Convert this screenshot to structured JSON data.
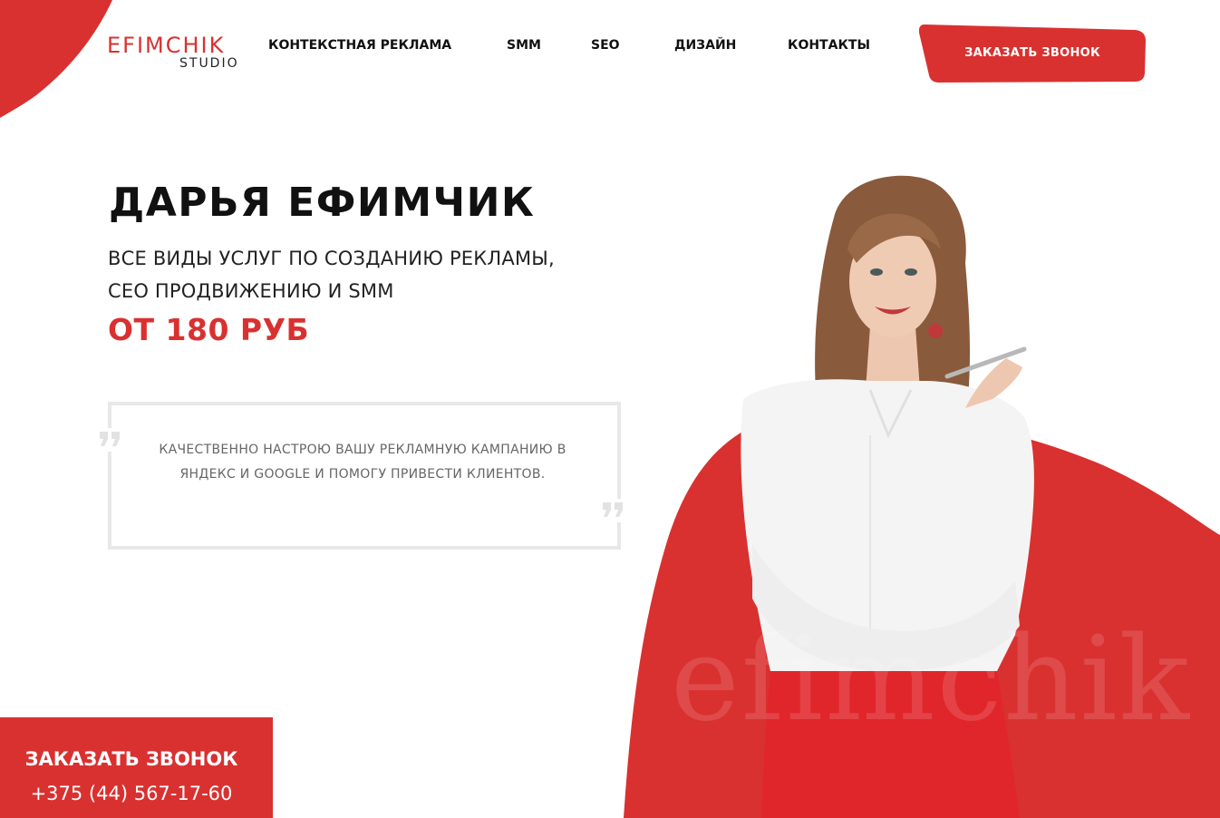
{
  "brand": {
    "logo_main": "EFIMCHIK",
    "logo_sub": "STUDIO",
    "accent_color": "#d93130",
    "watermark": "efimchik"
  },
  "nav": {
    "items": [
      {
        "label": "КОНТЕКСТНАЯ РЕКЛАМА"
      },
      {
        "label": "SMM"
      },
      {
        "label": "SEO"
      },
      {
        "label": "ДИЗАЙН"
      },
      {
        "label": "КОНТАКТЫ"
      }
    ]
  },
  "header": {
    "cta_label": "ЗАКАЗАТЬ ЗВОНОК"
  },
  "hero": {
    "name": "ДАРЬЯ ЕФИМЧИК",
    "subtitle_line1": "ВСЕ ВИДЫ УСЛУГ ПО СОЗДАНИЮ РЕКЛАМЫ,",
    "subtitle_line2": "СЕО ПРОДВИЖЕНИЮ И SMM",
    "price": "ОТ 180 РУБ",
    "quote": "КАЧЕСТВЕННО НАСТРОЮ ВАШУ РЕКЛАМНУЮ КАМПАНИЮ В ЯНДЕКС И GOOGLE И ПОМОГУ ПРИВЕСТИ КЛИЕНТОВ."
  },
  "callback": {
    "title": "ЗАКАЗАТЬ ЗВОНОК",
    "phone": "+375 (44) 567-17-60"
  },
  "icons": [
    "quote-open-icon",
    "quote-close-icon"
  ]
}
